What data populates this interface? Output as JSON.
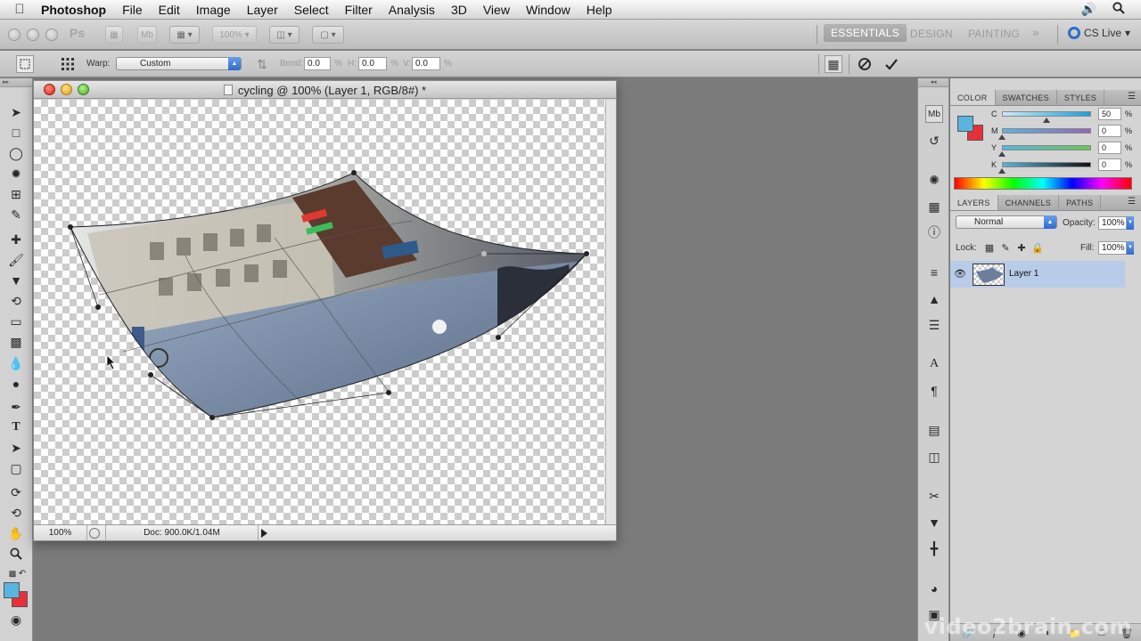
{
  "menubar": {
    "app_name": "Photoshop",
    "items": [
      "File",
      "Edit",
      "Image",
      "Layer",
      "Select",
      "Filter",
      "Analysis",
      "3D",
      "View",
      "Window",
      "Help"
    ]
  },
  "appbar": {
    "logo": "Ps",
    "zoom_value": "100%",
    "workspaces": [
      "ESSENTIALS",
      "DESIGN",
      "PAINTING"
    ],
    "more": "»",
    "cs_live": "CS Live"
  },
  "options": {
    "warp_label": "Warp:",
    "warp_value": "Custom",
    "bend_label": "Bend:",
    "bend_value": "0.0",
    "bend_unit": "%",
    "h_label": "H:",
    "h_value": "0.0",
    "h_unit": "%",
    "v_label": "V:",
    "v_value": "0.0",
    "v_unit": "%"
  },
  "document": {
    "title": "cycling @ 100% (Layer 1, RGB/8#) *",
    "zoom": "100%",
    "doc_info": "Doc: 900.0K/1.04M"
  },
  "color_panel": {
    "tabs": [
      "COLOR",
      "SWATCHES",
      "STYLES"
    ],
    "foreground": "#5ab4e0",
    "background": "#e8303a",
    "channels": [
      {
        "label": "C",
        "value": "50",
        "unit": "%"
      },
      {
        "label": "M",
        "value": "0",
        "unit": "%"
      },
      {
        "label": "Y",
        "value": "0",
        "unit": "%"
      },
      {
        "label": "K",
        "value": "0",
        "unit": "%"
      }
    ]
  },
  "layers_panel": {
    "tabs": [
      "LAYERS",
      "CHANNELS",
      "PATHS"
    ],
    "blend_mode": "Normal",
    "opacity_label": "Opacity:",
    "opacity_value": "100%",
    "lock_label": "Lock:",
    "fill_label": "Fill:",
    "fill_value": "100%",
    "layer_name": "Layer 1"
  },
  "watermark": "video2brain.com"
}
